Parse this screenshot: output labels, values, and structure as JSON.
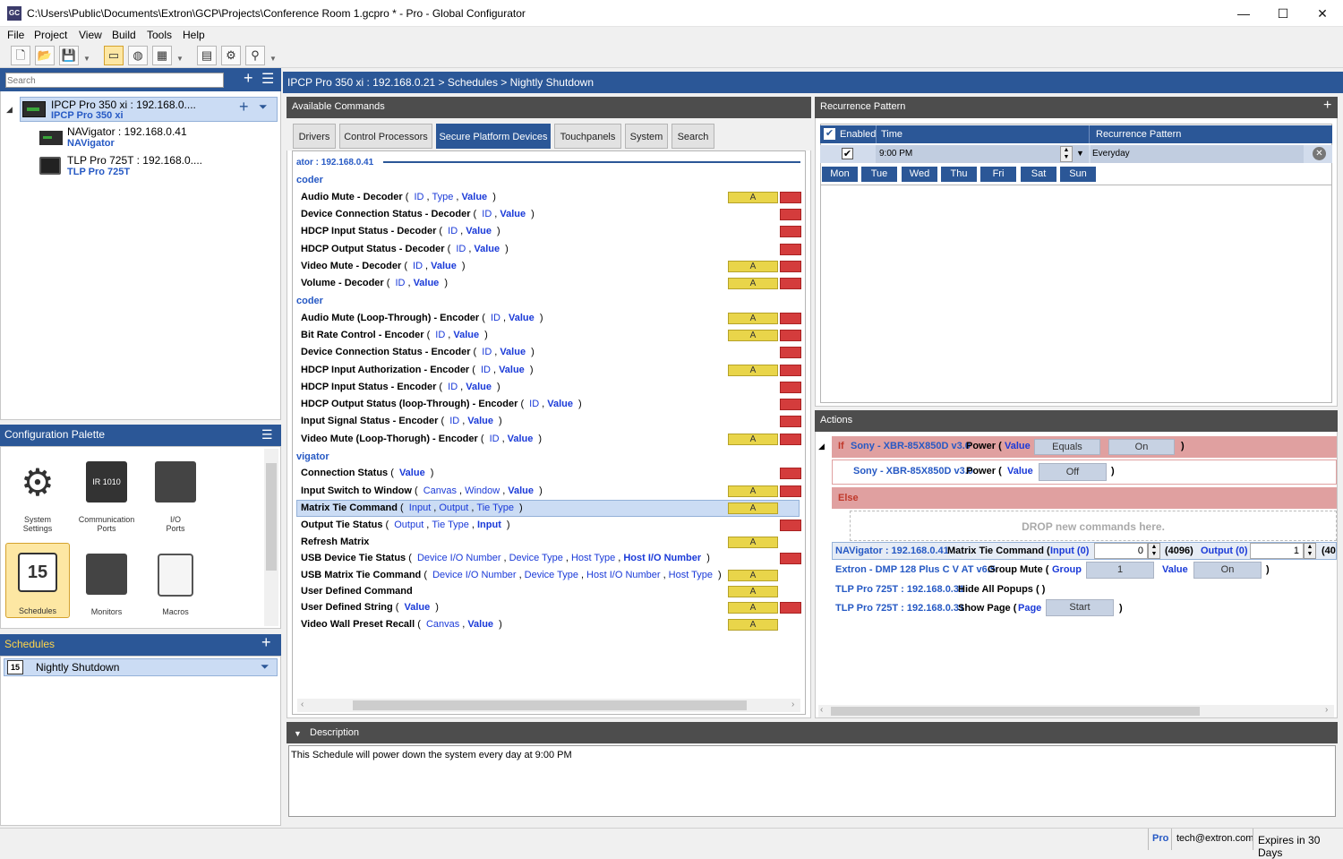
{
  "window": {
    "title": "C:\\Users\\Public\\Documents\\Extron\\GCP\\Projects\\Conference Room 1.gcpro * - Pro - Global Configurator",
    "app_icon": "GC",
    "minimize": "—",
    "maximize": "☐",
    "close": "✕"
  },
  "menu": [
    "File",
    "Project",
    "View",
    "Build",
    "Tools",
    "Help"
  ],
  "tree": {
    "search_placeholder": "Search",
    "devices": [
      {
        "name": "IPCP Pro 350 xi : 192.168.0....",
        "model": "IPCP Pro 350 xi"
      },
      {
        "name": "NAVigator : 192.168.0.41",
        "model": "NAVigator"
      },
      {
        "name": "TLP Pro 725T : 192.168.0....",
        "model": "TLP Pro 725T"
      }
    ]
  },
  "palette": {
    "title": "Configuration Palette",
    "items": [
      {
        "label": "System\nSettings",
        "icon": "gear-icon"
      },
      {
        "label": "Communication\nPorts",
        "icon": "ir-port-icon"
      },
      {
        "label": "I/O\nPorts",
        "icon": "io-port-icon"
      },
      {
        "label": "Schedules",
        "icon": "calendar-clock-icon",
        "day": "15"
      },
      {
        "label": "Monitors",
        "icon": "monitor-tools-icon"
      },
      {
        "label": "Macros",
        "icon": "scroll-icon"
      }
    ]
  },
  "schedules": {
    "title": "Schedules",
    "items": [
      "Nightly Shutdown"
    ],
    "day": "15"
  },
  "breadcrumb": "IPCP Pro 350 xi : 192.168.0.21 > Schedules > Nightly Shutdown",
  "available": {
    "title": "Available Commands",
    "tabs": [
      "Drivers",
      "Control Processors",
      "Secure Platform Devices",
      "Touchpanels",
      "System",
      "Search"
    ],
    "device_header": "ator : 192.168.0.41",
    "sections": [
      "coder",
      "coder",
      "vigator"
    ],
    "commands": [
      {
        "name": "Audio Mute - Decoder",
        "params": [
          "ID",
          "Type",
          "Value"
        ],
        "bold": [
          2
        ],
        "a": true,
        "r": true
      },
      {
        "name": "Device Connection Status - Decoder",
        "params": [
          "ID",
          "Value"
        ],
        "bold": [
          1
        ],
        "a": false,
        "r": true
      },
      {
        "name": "HDCP Input Status - Decoder",
        "params": [
          "ID",
          "Value"
        ],
        "bold": [
          1
        ],
        "a": false,
        "r": true
      },
      {
        "name": "HDCP Output Status - Decoder",
        "params": [
          "ID",
          "Value"
        ],
        "bold": [
          1
        ],
        "a": false,
        "r": true
      },
      {
        "name": "Video Mute - Decoder",
        "params": [
          "ID",
          "Value"
        ],
        "bold": [
          1
        ],
        "a": true,
        "r": true
      },
      {
        "name": "Volume - Decoder",
        "params": [
          "ID",
          "Value"
        ],
        "bold": [
          1
        ],
        "a": true,
        "r": true
      },
      {
        "name": "Audio Mute (Loop-Through) - Encoder",
        "params": [
          "ID",
          "Value"
        ],
        "bold": [
          1
        ],
        "a": true,
        "r": true
      },
      {
        "name": "Bit Rate Control - Encoder",
        "params": [
          "ID",
          "Value"
        ],
        "bold": [
          1
        ],
        "a": true,
        "r": true
      },
      {
        "name": "Device Connection Status - Encoder",
        "params": [
          "ID",
          "Value"
        ],
        "bold": [
          1
        ],
        "a": false,
        "r": true
      },
      {
        "name": "HDCP Input Authorization - Encoder",
        "params": [
          "ID",
          "Value"
        ],
        "bold": [
          1
        ],
        "a": true,
        "r": true
      },
      {
        "name": "HDCP Input Status - Encoder",
        "params": [
          "ID",
          "Value"
        ],
        "bold": [
          1
        ],
        "a": false,
        "r": true
      },
      {
        "name": "HDCP Output Status (loop-Through) - Encoder",
        "params": [
          "ID",
          "Value"
        ],
        "bold": [
          1
        ],
        "a": false,
        "r": true
      },
      {
        "name": "Input Signal Status - Encoder",
        "params": [
          "ID",
          "Value"
        ],
        "bold": [
          1
        ],
        "a": false,
        "r": true
      },
      {
        "name": "Video Mute (Loop-Thorugh) - Encoder",
        "params": [
          "ID",
          "Value"
        ],
        "bold": [
          1
        ],
        "a": true,
        "r": true
      },
      {
        "name": "Connection Status",
        "params": [
          "Value"
        ],
        "bold": [
          0
        ],
        "a": false,
        "r": true
      },
      {
        "name": "Input Switch to Window",
        "params": [
          "Canvas",
          "Window",
          "Value"
        ],
        "bold": [
          2
        ],
        "a": true,
        "r": true
      },
      {
        "name": "Matrix Tie Command",
        "params": [
          "Input",
          "Output",
          "Tie Type"
        ],
        "bold": [],
        "a": true,
        "r": false,
        "selected": true
      },
      {
        "name": "Output Tie Status",
        "params": [
          "Output",
          "Tie Type",
          "Input"
        ],
        "bold": [
          2
        ],
        "a": false,
        "r": true
      },
      {
        "name": "Refresh Matrix",
        "params": [],
        "bold": [],
        "a": true,
        "r": false
      },
      {
        "name": "USB Device Tie Status",
        "params": [
          "Device I/O Number",
          "Device Type",
          "Host Type",
          "Host I/O Number"
        ],
        "bold": [
          3
        ],
        "a": false,
        "r": true
      },
      {
        "name": "USB Matrix Tie Command",
        "params": [
          "Device I/O Number",
          "Device Type",
          "Host I/O Number",
          "Host Type"
        ],
        "bold": [],
        "a": true,
        "r": false
      },
      {
        "name": "User Defined Command",
        "params": [],
        "bold": [],
        "a": true,
        "r": false
      },
      {
        "name": "User Defined String",
        "params": [
          "Value"
        ],
        "bold": [
          0
        ],
        "a": true,
        "r": true
      },
      {
        "name": "Video Wall Preset Recall",
        "params": [
          "Canvas",
          "Value"
        ],
        "bold": [
          1
        ],
        "a": true,
        "r": false
      }
    ],
    "a_label": "A"
  },
  "recurrence": {
    "title": "Recurrence Pattern",
    "columns": [
      "Enabled",
      "Time",
      "Recurrence Pattern"
    ],
    "row": {
      "time": "9:00 PM",
      "pattern": "Everyday"
    },
    "days": [
      "Mon",
      "Tue",
      "Wed",
      "Thu",
      "Fri",
      "Sat",
      "Sun"
    ]
  },
  "actions": {
    "title": "Actions",
    "if_label": "If",
    "if_device": "Sony - XBR-85X850D v3.0",
    "if_cmd": "Power (",
    "if_param": "Value",
    "if_op": "Equals",
    "if_value": "On",
    "then_device": "Sony - XBR-85X850D v3.0",
    "then_cmd": "Power (",
    "then_param": "Value",
    "then_value": "Off",
    "else_label": "Else",
    "drop_hint": "DROP new commands here.",
    "lines": [
      {
        "device": "NAVigator : 192.168.0.41",
        "cmd": "Matrix Tie Command (",
        "p1": "Input (0)",
        "v1": "0",
        "mid": "(4096)",
        "p2": "Output (0)",
        "v2": "1",
        "tail": "(40"
      },
      {
        "device": "Extron - DMP 128 Plus C V AT v6.5",
        "cmd": "Group Mute (",
        "p1": "Group",
        "v1": "1",
        "p2": "Value",
        "v2": "On",
        "close": ")"
      },
      {
        "device": "TLP Pro 725T : 192.168.0.31",
        "cmd": "Hide All Popups ( )"
      },
      {
        "device": "TLP Pro 725T : 192.168.0.31",
        "cmd": "Show Page (",
        "p1": "Page",
        "v1": "Start",
        "close": ")"
      }
    ],
    "close_paren": ")"
  },
  "description": {
    "title": "Description",
    "text": "This Schedule will power down the system every day at 9:00 PM"
  },
  "status": {
    "edition": "Pro",
    "user": "tech@extron.com",
    "expiry": "Expires in 30 Days"
  }
}
